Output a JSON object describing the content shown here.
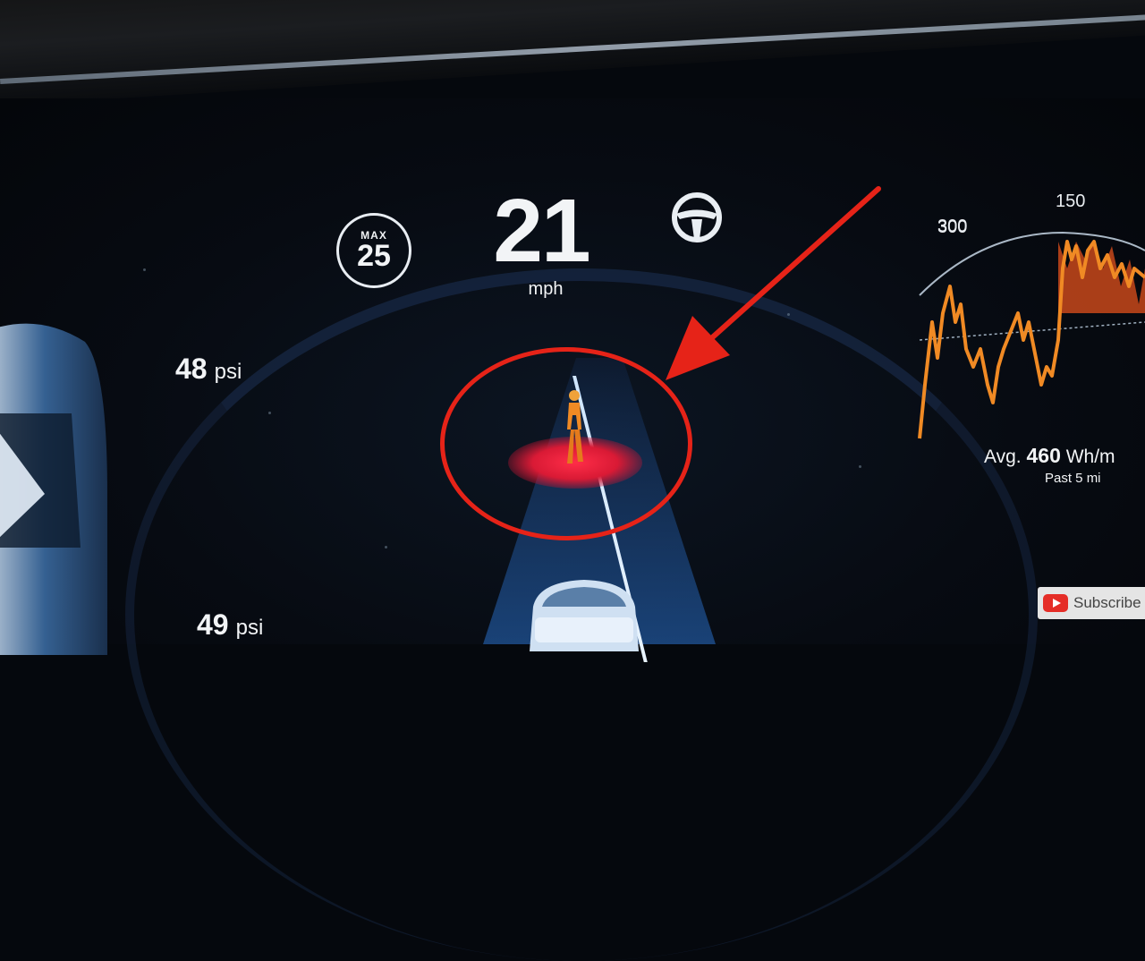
{
  "speed": {
    "max_label": "MAX",
    "max_value": "25",
    "value": "21",
    "unit": "mph"
  },
  "tires": {
    "front_left": {
      "value": "48",
      "unit": "psi"
    },
    "rear_left": {
      "value": "49",
      "unit": "psi"
    }
  },
  "energy": {
    "tick_300": "300",
    "tick_150": "150",
    "avg_label": "Avg.",
    "avg_value": "460",
    "avg_unit": "Wh/m",
    "past_label": "Past 5 mi"
  },
  "overlay": {
    "subscribe_label": "Subscribe"
  },
  "icons": {
    "steering": "steering-wheel-icon",
    "pedestrian": "pedestrian-icon",
    "arrow": "annotation-arrow-icon",
    "youtube": "youtube-icon"
  },
  "colors": {
    "highlight": "#e62318",
    "pedestrian_glow": "#ff2d48",
    "energy_line": "#f08a24",
    "road_blue": "#2e6fc8"
  }
}
